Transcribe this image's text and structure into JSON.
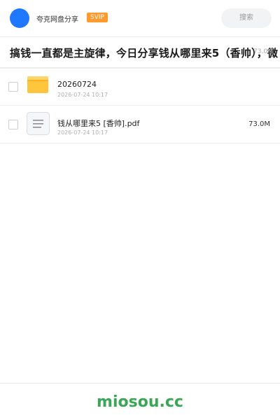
{
  "header": {
    "site_name": "夸克网盘分享",
    "badge": "SVIP",
    "search_label": "搜索"
  },
  "share": {
    "title": "搞钱一直都是主旋律，今日分享钱从哪里来5（香帅），微",
    "total_size": "73.0M"
  },
  "files": [
    {
      "type": "folder",
      "icon": "folder-icon",
      "name": "20260724",
      "date": "2026-07-24 10:17",
      "size": ""
    },
    {
      "type": "file",
      "icon": "document-icon",
      "name": "钱从哪里来5 [香帅].pdf",
      "date": "2026-07-24 10:17",
      "size": "73.0M"
    }
  ],
  "footer": {
    "brand": "miosou.cc"
  },
  "colors": {
    "avatar": "#1f78ff",
    "badge": "#ff9a2e",
    "folder": "#ffc53d",
    "brand": "#3aa757"
  }
}
